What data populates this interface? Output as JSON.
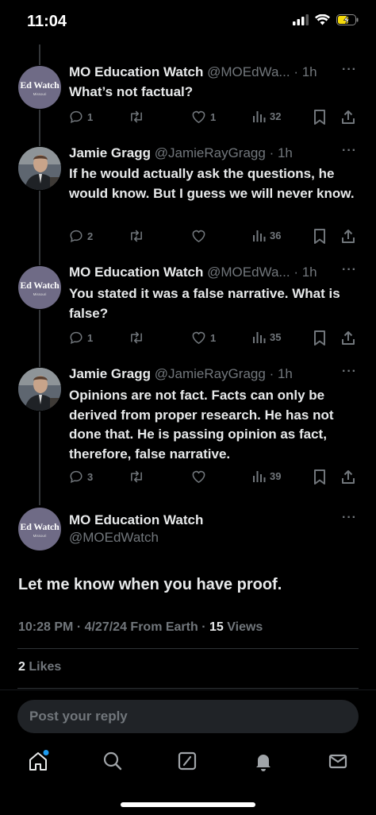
{
  "status_bar": {
    "time": "11:04"
  },
  "thread": [
    {
      "name": "MO Education Watch",
      "handle": "@MOEdWa...",
      "time": "· 1h",
      "text": "What’s not factual?",
      "replies": "1",
      "retweets": "",
      "likes": "1",
      "views": "32",
      "avatar": "edwatch"
    },
    {
      "name": "Jamie Gragg",
      "handle": "@JamieRayGragg",
      "time": "· 1h",
      "text": "If he would actually ask the questions, he would know. But I guess we will never know.",
      "replies": "2",
      "retweets": "",
      "likes": "",
      "views": "36",
      "avatar": "jamie"
    },
    {
      "name": "MO Education Watch",
      "handle": "@MOEdWa...",
      "time": "· 1h",
      "text": "You stated it was a false narrative. What is false?",
      "replies": "1",
      "retweets": "",
      "likes": "1",
      "views": "35",
      "avatar": "edwatch"
    },
    {
      "name": "Jamie Gragg",
      "handle": "@JamieRayGragg",
      "time": "· 1h",
      "text": "Opinions are not fact. Facts can only be derived from proper research. He has not done that. He is passing opinion as fact, therefore, false narrative.",
      "replies": "3",
      "retweets": "",
      "likes": "",
      "views": "39",
      "avatar": "jamie"
    }
  ],
  "avatar_text": {
    "line1": "Ed Watch",
    "line2": "Missouri"
  },
  "main_tweet": {
    "name": "MO Education Watch",
    "handle": "@MOEdWatch",
    "text": "Let me know when you have proof.",
    "timestamp": "10:28 PM · 4/27/24 From Earth ·",
    "views_count": "15",
    "views_label": "Views",
    "likes_count": "2",
    "likes_label": "Likes"
  },
  "reply": {
    "placeholder": "Post your reply"
  },
  "tabs": [
    "home",
    "search",
    "grok",
    "notifications",
    "messages"
  ],
  "colors": {
    "background": "#000000",
    "text": "#e7e9ea",
    "secondary": "#71767b",
    "accent": "#1d9bf0",
    "battery": "#f5d90a"
  }
}
